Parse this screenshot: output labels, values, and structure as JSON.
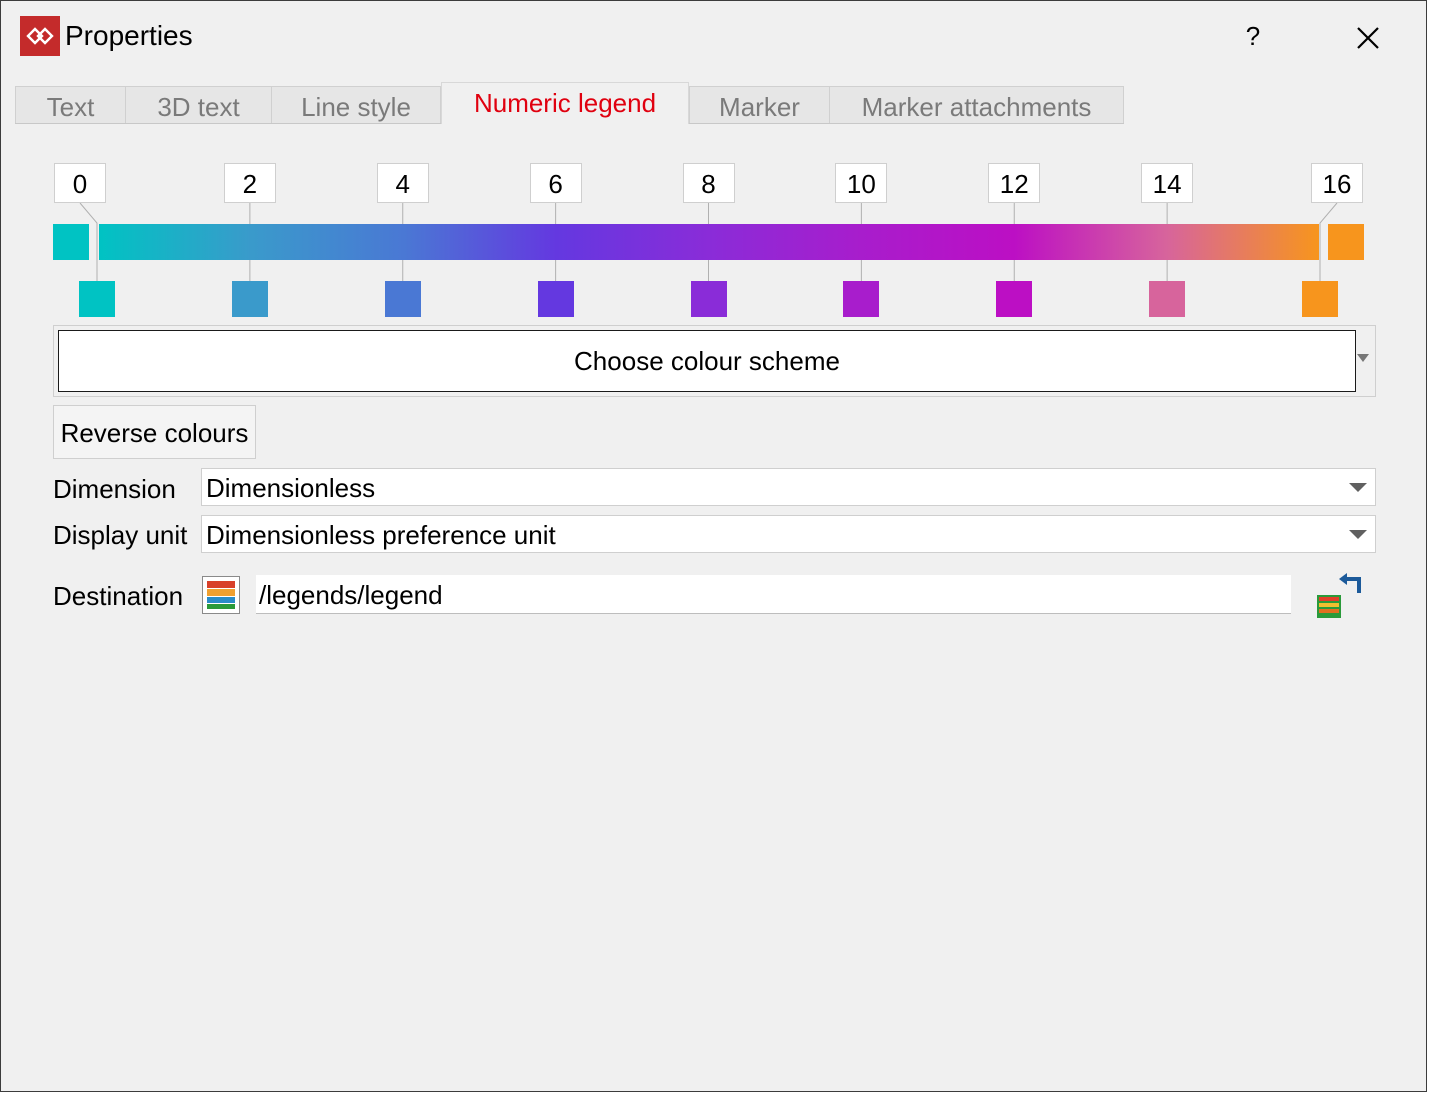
{
  "window": {
    "title": "Properties",
    "help_label": "?",
    "close_icon": "close-icon",
    "app_icon": "app-logo-icon",
    "brand_color": "#c42b2b"
  },
  "tabs": [
    {
      "label": "Text",
      "active": false
    },
    {
      "label": "3D text",
      "active": false
    },
    {
      "label": "Line style",
      "active": false
    },
    {
      "label": "Numeric legend",
      "active": true
    },
    {
      "label": "Marker",
      "active": false
    },
    {
      "label": "Marker attachments",
      "active": false
    }
  ],
  "legend": {
    "ticks": [
      "0",
      "2",
      "4",
      "6",
      "8",
      "10",
      "12",
      "14",
      "16"
    ],
    "swatch_colors": [
      "#00c3c3",
      "#3a9acb",
      "#4a78d4",
      "#6438e0",
      "#8a2cd8",
      "#a81dcc",
      "#bc0fc4",
      "#d7649c",
      "#f7951d"
    ],
    "gradient_stops": [
      "#00c3c3",
      "#3a9acb",
      "#4a78d4",
      "#6438e0",
      "#8a2cd8",
      "#a81dcc",
      "#bc0fc4",
      "#d7649c",
      "#f7951d"
    ],
    "start_cap_color": "#00c3c3",
    "end_cap_color": "#f7951d"
  },
  "controls": {
    "choose_scheme_label": "Choose colour scheme",
    "reverse_label": "Reverse colours",
    "dimension_label": "Dimension",
    "dimension_value": "Dimensionless",
    "display_unit_label": "Display unit",
    "display_unit_value": "Dimensionless preference unit",
    "destination_label": "Destination",
    "destination_value": "/legends/legend",
    "destination_icon": "legend-icon",
    "destination_button_icon": "select-legend-icon"
  }
}
